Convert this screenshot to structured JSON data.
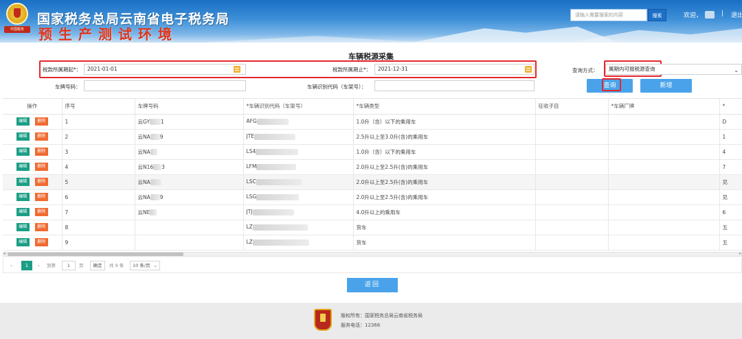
{
  "header": {
    "site_title": "国家税务总局云南省电子税务局",
    "env_title": "预生产测试环境",
    "emblem_text": "中国税务",
    "search_placeholder": "请输入需要搜索的内容",
    "search_button": "搜索",
    "welcome": "欢迎，",
    "separator": "|",
    "logout": "退出"
  },
  "page": {
    "title": "车辆税源采集"
  },
  "form": {
    "period_start_label": "税款所属期起*：",
    "period_start_value": "2021-01-01",
    "period_end_label": "税款所属期止*：",
    "period_end_value": "2021-12-31",
    "query_mode_label": "查询方式：",
    "query_mode_value": "属期内可报税源查询",
    "plate_label": "车牌号码：",
    "plate_value": "",
    "vin_label": "车辆识别代码（车架号）：",
    "vin_value": "",
    "query_button": "查询",
    "add_button": "新增"
  },
  "table": {
    "columns": [
      "操作",
      "序号",
      "车牌号码",
      "*车辆识别代码（车架号）",
      "*车辆类型",
      "征收子目",
      "*车辆厂牌",
      "*"
    ],
    "edit_label": "编辑",
    "delete_label": "删除",
    "rows": [
      {
        "no": "1",
        "plate": "云GY",
        "plate_tail": "1",
        "vin": "AFG",
        "type": "1.0升（含）以下的乘用车",
        "extra": "D"
      },
      {
        "no": "2",
        "plate": "云NA",
        "plate_tail": "9",
        "vin": "JTE",
        "type": "2.5升以上至3.0升(含)的乘用车",
        "extra": "1"
      },
      {
        "no": "3",
        "plate": "云NA",
        "plate_tail": "",
        "vin": "LS4",
        "type": "1.0升（含）以下的乘用车",
        "extra": "4"
      },
      {
        "no": "4",
        "plate": "云N16",
        "plate_tail": "3",
        "vin": "LFM",
        "type": "2.0升以上至2.5升(含)的乘用车",
        "extra": "7"
      },
      {
        "no": "5",
        "plate": "云NA",
        "plate_tail": "",
        "vin": "LSC",
        "type": "2.0升以上至2.5升(含)的乘用车",
        "extra": "见"
      },
      {
        "no": "6",
        "plate": "云NA",
        "plate_tail": "9",
        "vin": "LSG",
        "type": "2.0升以上至2.5升(含)的乘用车",
        "extra": "见"
      },
      {
        "no": "7",
        "plate": "云NE",
        "plate_tail": "",
        "vin": "JTJ",
        "type": "4.0升以上的乘用车",
        "extra": "6"
      },
      {
        "no": "8",
        "plate": "",
        "plate_tail": "",
        "vin": "LZ",
        "type": "货车",
        "extra": "五"
      },
      {
        "no": "9",
        "plate": "",
        "plate_tail": "",
        "vin": "LZ",
        "type": "货车",
        "extra": "五"
      }
    ]
  },
  "pager": {
    "current_page": "1",
    "goto_label": "到第",
    "goto_value": "1",
    "page_unit": "页",
    "confirm": "确定",
    "total": "共 9 条",
    "page_size": "10 条/页"
  },
  "return_button": "返回",
  "footer": {
    "copyright": "版权所有：国家税务总局云南省税务局",
    "phone": "服务电话：12366"
  },
  "colors": {
    "header_blue": "#1a6fc4",
    "button_blue": "#4aa3ea",
    "edit_green": "#1b9e86",
    "delete_orange": "#f06a31",
    "highlight_red": "#e3262b"
  }
}
